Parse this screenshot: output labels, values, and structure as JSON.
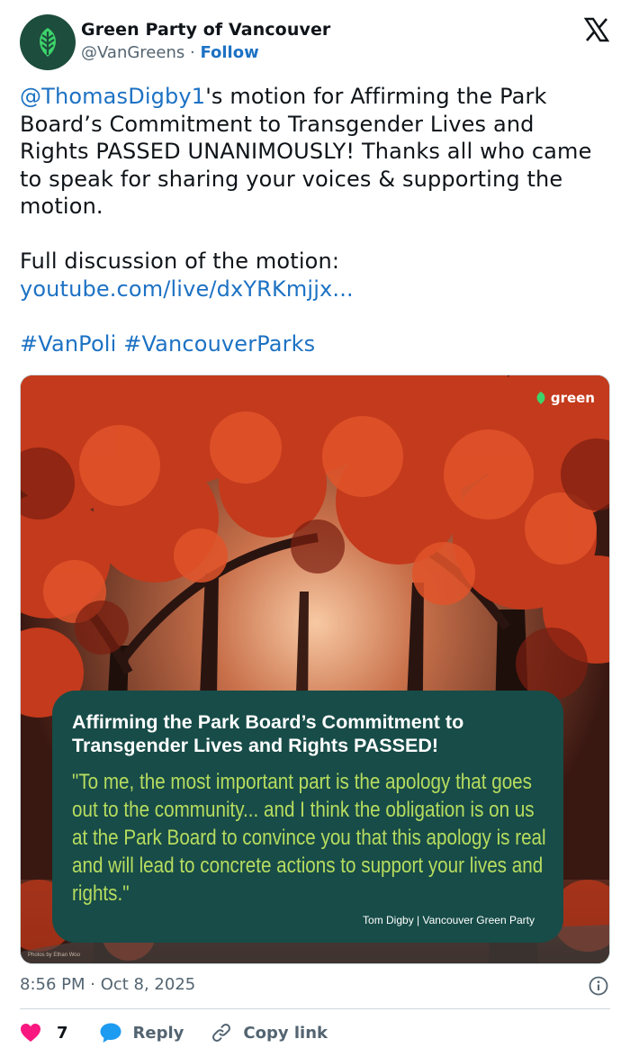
{
  "account": {
    "name": "Green Party of Vancouver",
    "handle": "@VanGreens",
    "separator": "·",
    "follow_label": "Follow"
  },
  "tweet": {
    "mention": "@ThomasDigby1",
    "text_after_mention": "'s motion for Affirming the Park Board’s Commitment to Transgender Lives and Rights PASSED UNANIMOUSLY! Thanks all who came to speak for sharing your voices & supporting the motion.",
    "discussion_label": "Full discussion of the motion:",
    "link": "youtube.com/live/dxYRKmjjx...",
    "hashtag_1": "#VanPoli",
    "hashtag_2": "#VancouverParks"
  },
  "media": {
    "logo_text": "green",
    "card_title": "Affirming the Park Board’s Commitment to Transgender Lives and Rights PASSED!",
    "card_quote": "\"To me, the most important part is the apology that goes out to the community... and I think the obligation is on us at the Park Board to convince you that this apology is real and will lead to concrete actions to support your lives and rights.\"",
    "card_attribution": "Tom Digby | Vancouver Green Party",
    "photo_credit": "Photos by Ethan Woo"
  },
  "meta": {
    "timestamp": "8:56 PM · Oct 8, 2025"
  },
  "actions": {
    "like_count": "7",
    "reply_label": "Reply",
    "copy_link_label": "Copy link"
  },
  "colors": {
    "link": "#1d72c4",
    "card_bg": "#174c48",
    "quote": "#b7dc5f",
    "heart": "#f91880",
    "reply": "#1d9bf0"
  }
}
